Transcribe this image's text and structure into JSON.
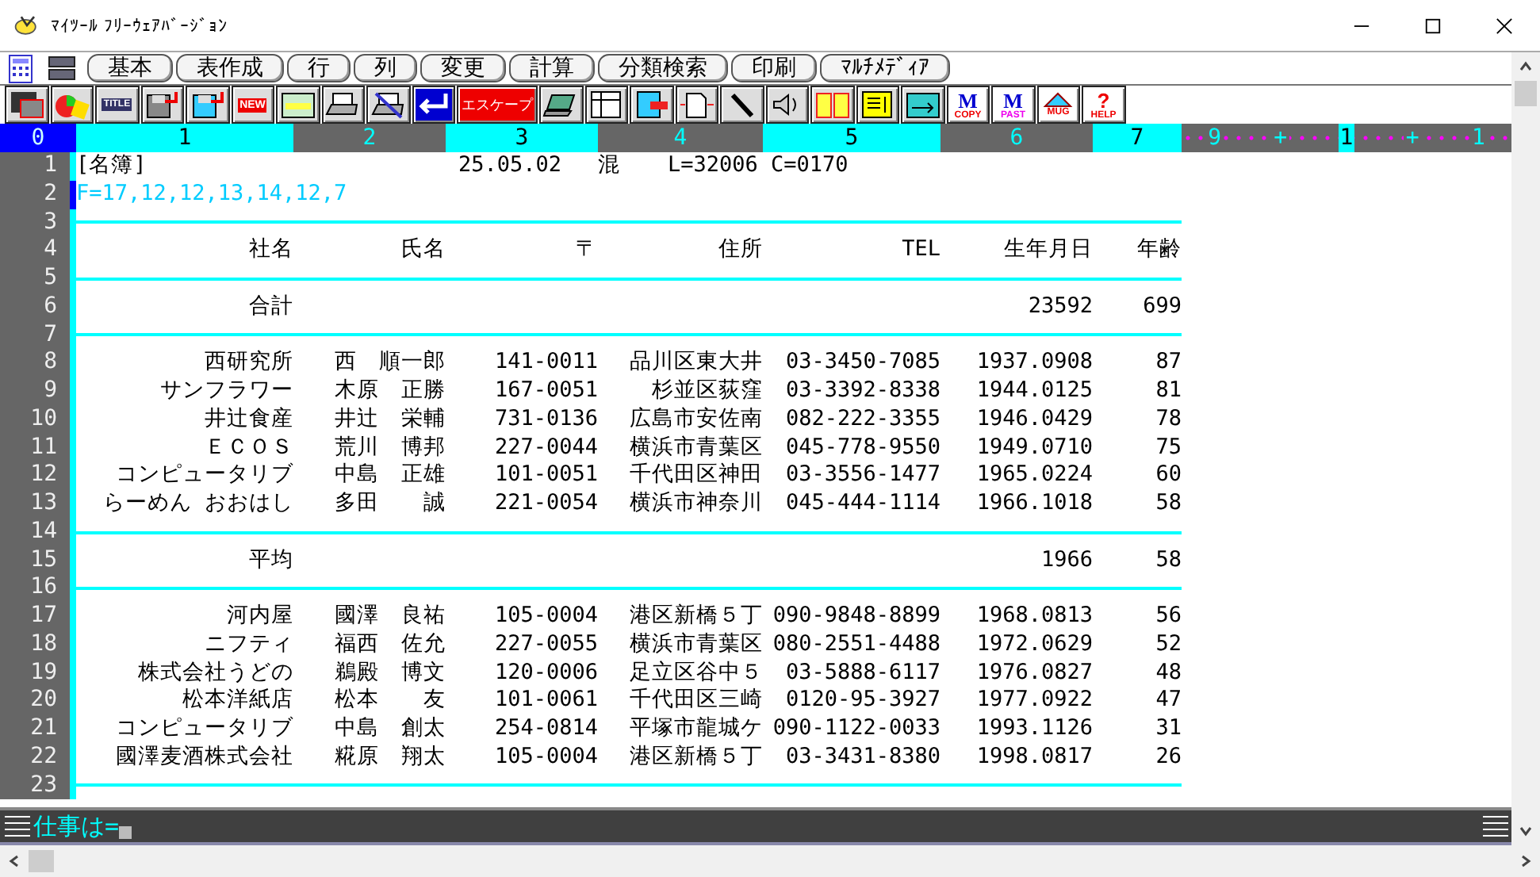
{
  "window": {
    "title": "ﾏｲﾂｰﾙ ﾌﾘｰｳｪｱﾊﾞｰｼﾞｮﾝ"
  },
  "menu": [
    "基本",
    "表作成",
    "行",
    "列",
    "変更",
    "計算",
    "分類検索",
    "印刷",
    "ﾏﾙﾁﾒﾃﾞｨｱ"
  ],
  "toolbar": {
    "title_icon": "TITLE",
    "new_icon": "NEW",
    "escape": "エスケープ",
    "copy": {
      "mark": "M",
      "label": "COPY"
    },
    "paste": {
      "mark": "M",
      "label": "PAST"
    },
    "mug": "MUG",
    "help": {
      "mark": "?",
      "label": "HELP"
    }
  },
  "ruler": [
    {
      "text": "0",
      "kind": "active"
    },
    {
      "text": "1",
      "kind": "light"
    },
    {
      "text": "2",
      "kind": "dark"
    },
    {
      "text": "3",
      "kind": "light"
    },
    {
      "text": "4",
      "kind": "dark"
    },
    {
      "text": "5",
      "kind": "light"
    },
    {
      "text": "6",
      "kind": "dark"
    },
    {
      "text": "7",
      "kind": "light"
    }
  ],
  "ruler_tail": [
    {
      "text": "9",
      "highlighted": false
    },
    {
      "text": "+",
      "highlighted": false
    },
    {
      "text": "1",
      "highlighted": true
    },
    {
      "text": "+",
      "highlighted": false
    },
    {
      "text": "1",
      "highlighted": false
    }
  ],
  "lines": [
    {
      "number": "1",
      "selected": false,
      "kind": "title",
      "title": "[名簿]",
      "date": "25.05.02",
      "mode": "混",
      "position": "L=32006 C=0170"
    },
    {
      "number": "2",
      "selected": true,
      "kind": "format",
      "text": "F=17,12,12,13,14,12,7"
    },
    {
      "number": "3",
      "selected": false,
      "kind": "rule"
    },
    {
      "number": "4",
      "selected": false,
      "kind": "header",
      "cells": [
        "社名",
        "氏名",
        "〒",
        "住所",
        "TEL",
        "生年月日",
        "年齢"
      ]
    },
    {
      "number": "5",
      "selected": false,
      "kind": "rule"
    },
    {
      "number": "6",
      "selected": false,
      "kind": "summary",
      "label": "合計",
      "values": [
        "23592",
        "699"
      ]
    },
    {
      "number": "7",
      "selected": false,
      "kind": "rule"
    },
    {
      "number": "8",
      "selected": false,
      "kind": "data",
      "cells": [
        "西研究所",
        "西　順一郎",
        "141-0011",
        "品川区東大井",
        "03-3450-7085",
        "1937.0908",
        "87"
      ]
    },
    {
      "number": "9",
      "selected": false,
      "kind": "data",
      "cells": [
        "サンフラワー",
        "木原　正勝",
        "167-0051",
        "杉並区荻窪",
        "03-3392-8338",
        "1944.0125",
        "81"
      ]
    },
    {
      "number": "10",
      "selected": false,
      "kind": "data",
      "cells": [
        "井辻食産",
        "井辻　栄輔",
        "731-0136",
        "広島市安佐南",
        "082-222-3355",
        "1946.0429",
        "78"
      ]
    },
    {
      "number": "11",
      "selected": false,
      "kind": "data",
      "cells": [
        "ＥＣＯＳ",
        "荒川　博邦",
        "227-0044",
        "横浜市青葉区",
        "045-778-9550",
        "1949.0710",
        "75"
      ]
    },
    {
      "number": "12",
      "selected": false,
      "kind": "data",
      "cells": [
        "コンピュータリブ",
        "中島　正雄",
        "101-0051",
        "千代田区神田",
        "03-3556-1477",
        "1965.0224",
        "60"
      ]
    },
    {
      "number": "13",
      "selected": false,
      "kind": "data",
      "cells": [
        "らーめん おおはし",
        "多田　　誠",
        "221-0054",
        "横浜市神奈川",
        "045-444-1114",
        "1966.1018",
        "58"
      ]
    },
    {
      "number": "14",
      "selected": false,
      "kind": "rule"
    },
    {
      "number": "15",
      "selected": false,
      "kind": "summary",
      "label": "平均",
      "values": [
        "1966",
        "58"
      ]
    },
    {
      "number": "16",
      "selected": false,
      "kind": "rule"
    },
    {
      "number": "17",
      "selected": false,
      "kind": "data",
      "cells": [
        "河内屋",
        "國澤　良祐",
        "105-0004",
        "港区新橋５丁",
        "090-9848-8899",
        "1968.0813",
        "56"
      ]
    },
    {
      "number": "18",
      "selected": false,
      "kind": "data",
      "cells": [
        "ニフティ",
        "福西　佐允",
        "227-0055",
        "横浜市青葉区",
        "080-2551-4488",
        "1972.0629",
        "52"
      ]
    },
    {
      "number": "19",
      "selected": false,
      "kind": "data",
      "cells": [
        "株式会社うどの",
        "鵜殿　博文",
        "120-0006",
        "足立区谷中５",
        "03-5888-6117",
        "1976.0827",
        "48"
      ]
    },
    {
      "number": "20",
      "selected": false,
      "kind": "data",
      "cells": [
        "松本洋紙店",
        "松本　　友",
        "101-0061",
        "千代田区三崎",
        "0120-95-3927",
        "1977.0922",
        "47"
      ]
    },
    {
      "number": "21",
      "selected": false,
      "kind": "data",
      "cells": [
        "コンピュータリブ",
        "中島　創太",
        "254-0814",
        "平塚市龍城ケ",
        "090-1122-0033",
        "1993.1126",
        "31"
      ]
    },
    {
      "number": "22",
      "selected": false,
      "kind": "data",
      "cells": [
        "國澤麦酒株式会社",
        "糀原　翔太",
        "105-0004",
        "港区新橋５丁",
        "03-3431-8380",
        "1998.0817",
        "26"
      ]
    },
    {
      "number": "23",
      "selected": false,
      "kind": "rule"
    }
  ],
  "command": {
    "prompt": "仕事は="
  }
}
